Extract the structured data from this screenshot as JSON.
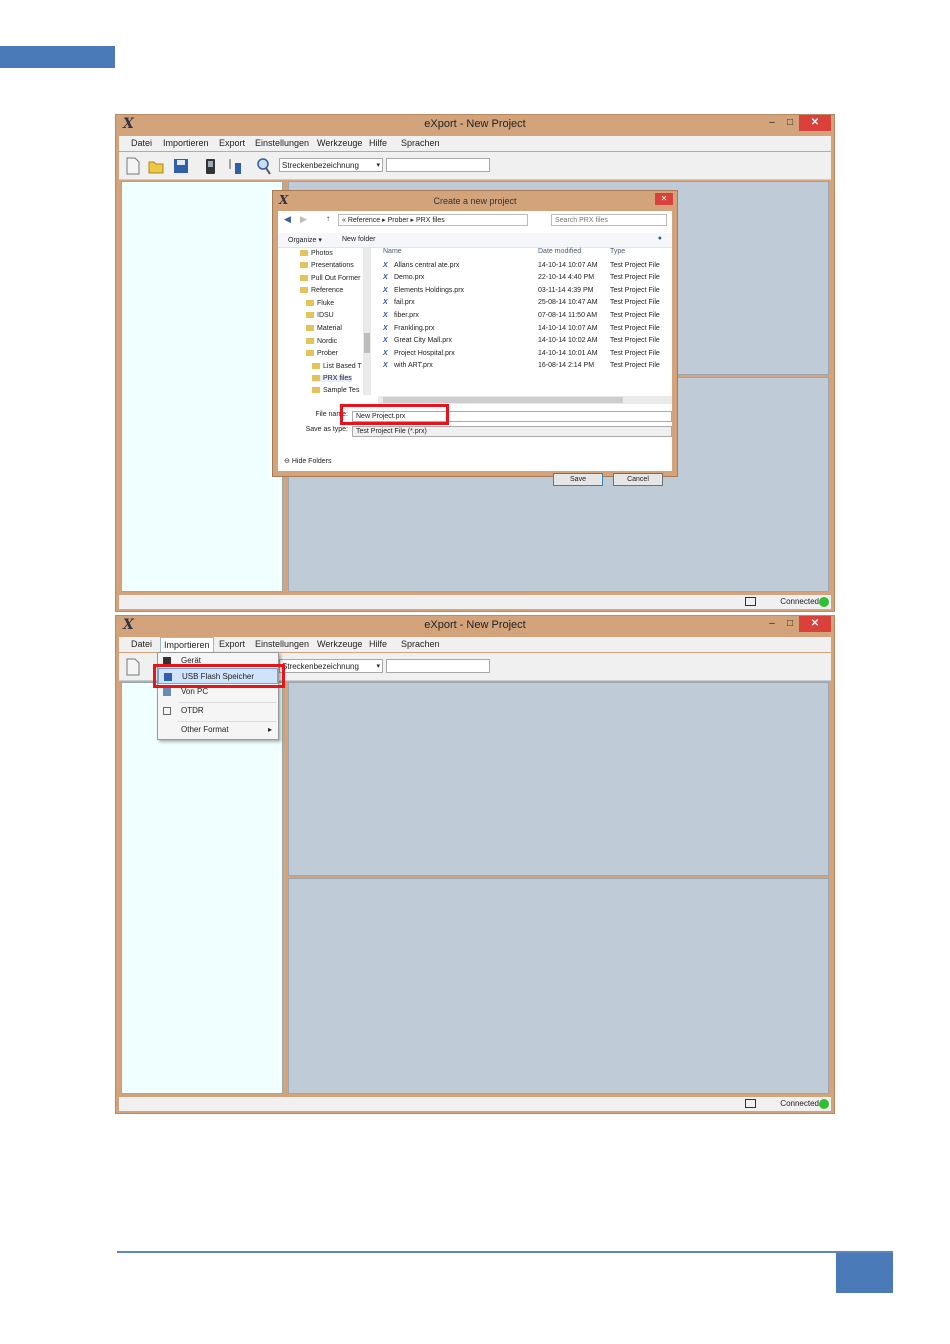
{
  "app": {
    "title": "eXport - New Project",
    "icon_glyph": "X",
    "window_controls": {
      "minimize": "–",
      "maximize": "□",
      "close": "✕"
    },
    "menu": [
      "Datei",
      "Importieren",
      "Export",
      "Einstellungen",
      "Werkzeuge",
      "Hilfe",
      "Sprachen"
    ],
    "toolbar": {
      "select_value": "Streckenbezeichnung"
    },
    "status": {
      "text": "Connected"
    }
  },
  "dialog": {
    "title": "Create a new project",
    "breadcrumb": [
      "«",
      "Reference",
      "Prober",
      "PRX files"
    ],
    "search_placeholder": "Search PRX files",
    "organize_label": "Organize ▾",
    "new_folder_label": "New folder",
    "tree": [
      "Photos",
      "Presentations",
      "Pull Out Former",
      "Reference",
      "Fluke",
      "IDSU",
      "Material",
      "Nordic",
      "Prober",
      "List Based T",
      "PRX files",
      "Sample Tes"
    ],
    "columns": {
      "name": "Name",
      "date": "Date modified",
      "type": "Type"
    },
    "files": [
      {
        "name": "Allans central ate.prx",
        "date": "14-10-14 10:07 AM",
        "type": "Test Project File"
      },
      {
        "name": "Demo.prx",
        "date": "22-10-14 4:40 PM",
        "type": "Test Project File"
      },
      {
        "name": "Elements Holdings.prx",
        "date": "03-11-14 4:39 PM",
        "type": "Test Project File"
      },
      {
        "name": "fail.prx",
        "date": "25-08-14 10:47 AM",
        "type": "Test Project File"
      },
      {
        "name": "fiber.prx",
        "date": "07-08-14 11:50 AM",
        "type": "Test Project File"
      },
      {
        "name": "Frankling.prx",
        "date": "14-10-14 10:07 AM",
        "type": "Test Project File"
      },
      {
        "name": "Great City Mall.prx",
        "date": "14-10-14 10:02 AM",
        "type": "Test Project File"
      },
      {
        "name": "Project Hospital.prx",
        "date": "14-10-14 10:01 AM",
        "type": "Test Project File"
      },
      {
        "name": "with ART.prx",
        "date": "16-08-14 2:14 PM",
        "type": "Test Project File"
      }
    ],
    "file_name_label": "File name:",
    "file_name_value": "New Project.prx",
    "save_type_label": "Save as type:",
    "save_type_value": "Test Project File (*.prx)",
    "hide_folders": "Hide Folders",
    "save_button": "Save",
    "cancel_button": "Cancel"
  },
  "import_menu": {
    "items": [
      "Gerät",
      "USB Flash Speicher",
      "Von PC",
      "OTDR",
      "Other Format"
    ],
    "submenu_arrow": "▸"
  },
  "colors": {
    "window_frame": "#d3a37b",
    "highlight_red": "#e8141b",
    "status_green": "#2fc02f",
    "pane_blue": "#bfccd8",
    "left_pane": "#f0ffff"
  }
}
